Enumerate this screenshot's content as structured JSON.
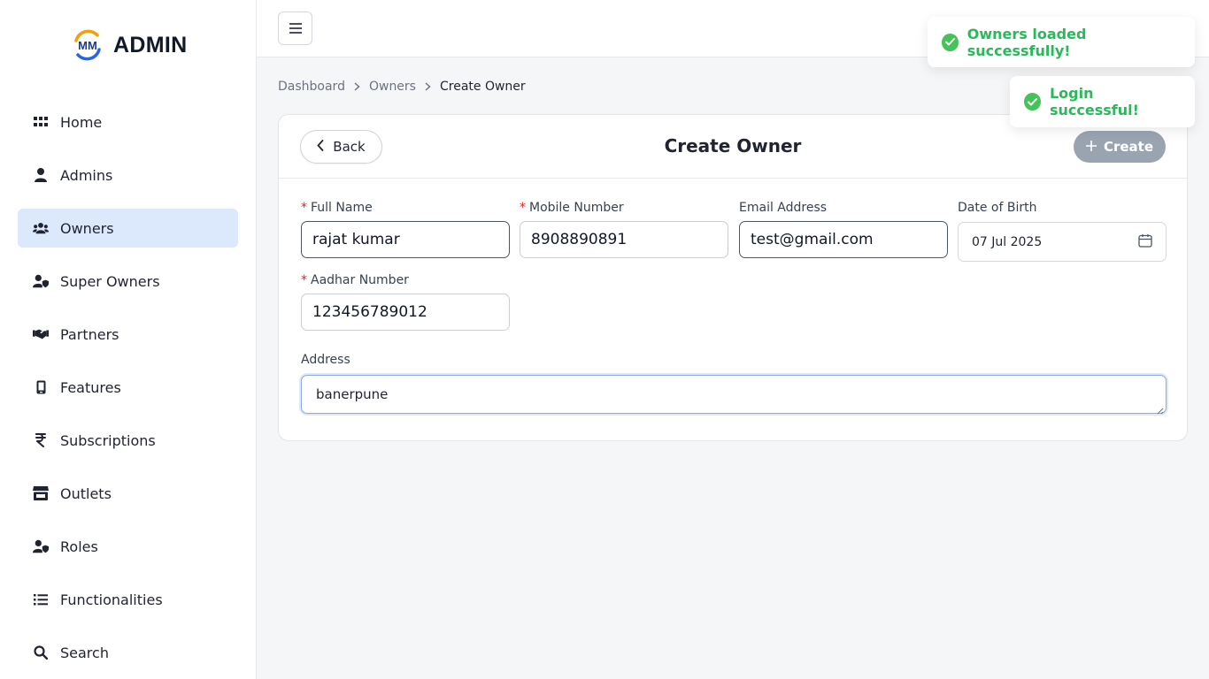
{
  "brand": {
    "logo_text": "MM",
    "title": "ADMIN"
  },
  "sidebar": {
    "items": [
      {
        "label": "Home",
        "icon": "grid-icon"
      },
      {
        "label": "Admins",
        "icon": "user-icon"
      },
      {
        "label": "Owners",
        "icon": "users-icon",
        "active": true
      },
      {
        "label": "Super Owners",
        "icon": "user-shield-icon"
      },
      {
        "label": "Partners",
        "icon": "handshake-icon"
      },
      {
        "label": "Features",
        "icon": "mobile-icon"
      },
      {
        "label": "Subscriptions",
        "icon": "rupee-icon"
      },
      {
        "label": "Outlets",
        "icon": "store-icon"
      },
      {
        "label": "Roles",
        "icon": "user-shield-icon"
      },
      {
        "label": "Functionalities",
        "icon": "list-icon"
      },
      {
        "label": "Search",
        "icon": "search-icon"
      }
    ]
  },
  "breadcrumb": {
    "items": [
      "Dashboard",
      "Owners",
      "Create Owner"
    ]
  },
  "card": {
    "title": "Create Owner",
    "back_label": "Back",
    "create_label": "Create"
  },
  "form": {
    "full_name": {
      "label": "Full Name",
      "value": "rajat kumar",
      "required": true
    },
    "mobile": {
      "label": "Mobile Number",
      "value": "8908890891",
      "required": true
    },
    "email": {
      "label": "Email Address",
      "value": "test@gmail.com"
    },
    "dob": {
      "label": "Date of Birth",
      "value": "07 Jul 2025"
    },
    "aadhar": {
      "label": "Aadhar Number",
      "value": "123456789012",
      "required": true
    },
    "address": {
      "label": "Address",
      "value": "banerpune"
    }
  },
  "toasts": [
    {
      "message": "Owners loaded successfully!"
    },
    {
      "message": "Login successful!"
    }
  ],
  "colors": {
    "accent_active": "#dce8fc",
    "success": "#2bb85b",
    "required": "#dc2626",
    "create_disabled": "#9aa4b1"
  }
}
